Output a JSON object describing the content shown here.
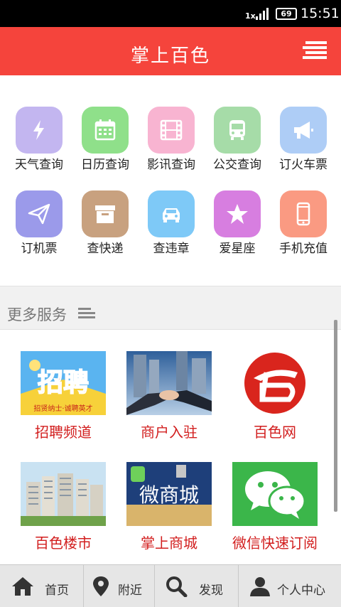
{
  "status_bar": {
    "network": "1x",
    "battery": "69",
    "time": "15:51"
  },
  "header": {
    "title": "掌上百色"
  },
  "services": [
    {
      "label": "天气查询",
      "icon": "lightning-icon",
      "color": "#c3b6f0"
    },
    {
      "label": "日历查询",
      "icon": "calendar-icon",
      "color": "#8fe08a"
    },
    {
      "label": "影讯查询",
      "icon": "film-icon",
      "color": "#f8b4d1"
    },
    {
      "label": "公交查询",
      "icon": "bus-icon",
      "color": "#a6dca8"
    },
    {
      "label": "订火车票",
      "icon": "megaphone-icon",
      "color": "#aecdf6"
    },
    {
      "label": "订机票",
      "icon": "paper-plane-icon",
      "color": "#9b9aea"
    },
    {
      "label": "查快递",
      "icon": "box-icon",
      "color": "#c8a17f"
    },
    {
      "label": "查违章",
      "icon": "car-icon",
      "color": "#7ec9f7"
    },
    {
      "label": "爱星座",
      "icon": "star-icon",
      "color": "#d77ee0"
    },
    {
      "label": "手机充值",
      "icon": "phone-icon",
      "color": "#fa9a82"
    }
  ],
  "more_services": {
    "title": "更多服务"
  },
  "promos": [
    {
      "label": "招聘频道",
      "image_text": "招聘",
      "image_subtext": "招贤纳士·诚聘英才"
    },
    {
      "label": "商户入驻"
    },
    {
      "label": "百色网"
    },
    {
      "label": "百色楼市"
    },
    {
      "label": "掌上商城",
      "image_text": "微商城"
    },
    {
      "label": "微信快速订阅"
    }
  ],
  "bottom_nav": [
    {
      "label": "首页",
      "icon": "home-icon"
    },
    {
      "label": "附近",
      "icon": "location-pin-icon"
    },
    {
      "label": "发现",
      "icon": "search-icon"
    },
    {
      "label": "个人中心",
      "icon": "person-icon"
    }
  ]
}
